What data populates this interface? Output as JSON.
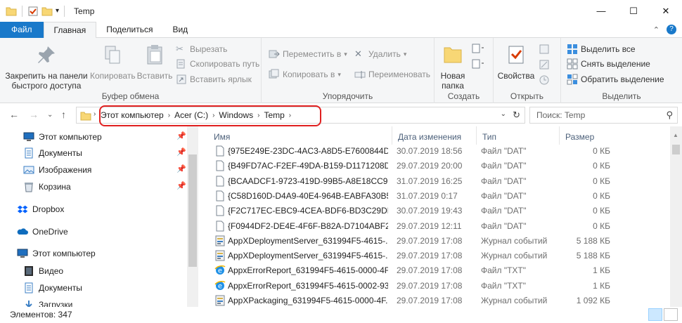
{
  "window": {
    "title": "Temp"
  },
  "tabs": [
    "Файл",
    "Главная",
    "Поделиться",
    "Вид"
  ],
  "ribbon": {
    "clipboard": {
      "label": "Буфер обмена",
      "pin_line1": "Закрепить на панели",
      "pin_line2": "быстрого доступа",
      "copy": "Копировать",
      "paste": "Вставить",
      "cut": "Вырезать",
      "copy_path": "Скопировать путь",
      "paste_shortcut": "Вставить ярлык"
    },
    "organize": {
      "label": "Упорядочить",
      "move_to": "Переместить в",
      "copy_to": "Копировать в",
      "delete": "Удалить",
      "rename": "Переименовать"
    },
    "create": {
      "label": "Создать",
      "new_folder_line1": "Новая",
      "new_folder_line2": "папка"
    },
    "open": {
      "label": "Открыть",
      "properties": "Свойства"
    },
    "select": {
      "label": "Выделить",
      "select_all": "Выделить все",
      "select_none": "Снять выделение",
      "invert": "Обратить выделение"
    }
  },
  "address": {
    "crumbs": [
      "Этот компьютер",
      "Acer (C:)",
      "Windows",
      "Temp"
    ],
    "search_placeholder": "Поиск: Temp"
  },
  "nav_pane": [
    {
      "label": "Этот компьютер",
      "icon": "computer-icon",
      "pinned": true
    },
    {
      "label": "Документы",
      "icon": "documents-icon",
      "pinned": true
    },
    {
      "label": "Изображения",
      "icon": "pictures-icon",
      "pinned": true
    },
    {
      "label": "Корзина",
      "icon": "recycle-bin-icon",
      "pinned": true
    },
    {
      "label": "Dropbox",
      "icon": "dropbox-icon",
      "pinned": false
    },
    {
      "label": "OneDrive",
      "icon": "onedrive-icon",
      "pinned": false
    },
    {
      "label": "Этот компьютер",
      "icon": "computer-icon",
      "pinned": false
    },
    {
      "label": "Видео",
      "icon": "video-icon",
      "pinned": false
    },
    {
      "label": "Документы",
      "icon": "documents-icon",
      "pinned": false
    },
    {
      "label": "Загрузки",
      "icon": "downloads-icon",
      "pinned": false
    }
  ],
  "columns": [
    "Имя",
    "Дата изменения",
    "Тип",
    "Размер"
  ],
  "files": [
    {
      "name": "{975E249E-23DC-4AC3-A8D5-E7600844D...",
      "date": "30.07.2019 18:56",
      "type": "Файл \"DAT\"",
      "size": "0 КБ",
      "icon": "dat-file-icon"
    },
    {
      "name": "{B49FD7AC-F2EF-49DA-B159-D1171208D...",
      "date": "29.07.2019 20:00",
      "type": "Файл \"DAT\"",
      "size": "0 КБ",
      "icon": "dat-file-icon"
    },
    {
      "name": "{BCAADCF1-9723-419D-99B5-A8E18CC9...",
      "date": "31.07.2019 16:25",
      "type": "Файл \"DAT\"",
      "size": "0 КБ",
      "icon": "dat-file-icon"
    },
    {
      "name": "{C58D160D-D4A9-40E4-964B-EABFA30B5...",
      "date": "31.07.2019 0:17",
      "type": "Файл \"DAT\"",
      "size": "0 КБ",
      "icon": "dat-file-icon"
    },
    {
      "name": "{F2C717EC-EBC9-4CEA-BDF6-BD3C29DD...",
      "date": "30.07.2019 19:43",
      "type": "Файл \"DAT\"",
      "size": "0 КБ",
      "icon": "dat-file-icon"
    },
    {
      "name": "{F0944DF2-DE4E-4F6F-B82A-D7104ABF29...",
      "date": "29.07.2019 12:11",
      "type": "Файл \"DAT\"",
      "size": "0 КБ",
      "icon": "dat-file-icon"
    },
    {
      "name": "AppXDeploymentServer_631994F5-4615-...",
      "date": "29.07.2019 17:08",
      "type": "Журнал событий",
      "size": "5 188 КБ",
      "icon": "event-log-icon"
    },
    {
      "name": "AppXDeploymentServer_631994F5-4615-...",
      "date": "29.07.2019 17:08",
      "type": "Журнал событий",
      "size": "5 188 КБ",
      "icon": "event-log-icon"
    },
    {
      "name": "AppxErrorReport_631994F5-4615-0000-4F...",
      "date": "29.07.2019 17:08",
      "type": "Файл \"TXT\"",
      "size": "1 КБ",
      "icon": "ie-text-icon"
    },
    {
      "name": "AppxErrorReport_631994F5-4615-0002-93...",
      "date": "29.07.2019 17:08",
      "type": "Файл \"TXT\"",
      "size": "1 КБ",
      "icon": "ie-text-icon"
    },
    {
      "name": "AppXPackaging_631994F5-4615-0000-4F...",
      "date": "29.07.2019 17:08",
      "type": "Журнал событий",
      "size": "1 092 КБ",
      "icon": "event-log-icon"
    }
  ],
  "status": {
    "items": "Элементов: 347"
  }
}
